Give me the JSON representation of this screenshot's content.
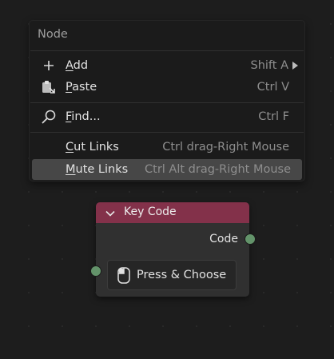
{
  "menu": {
    "title": "Node",
    "items": [
      {
        "label_u": "A",
        "label_rest": "dd",
        "shortcut": "Shift A",
        "icon": "plus-icon",
        "submenu": true
      },
      {
        "label_u": "P",
        "label_rest": "aste",
        "shortcut": "Ctrl V",
        "icon": "paste-icon"
      },
      {
        "label_u": "F",
        "label_rest": "ind...",
        "shortcut": "Ctrl F",
        "icon": "search-icon"
      },
      {
        "label_u": "C",
        "label_rest": "ut Links",
        "shortcut": "Ctrl drag-Right Mouse"
      },
      {
        "label_u": "M",
        "label_rest": "ute Links",
        "shortcut": "Ctrl Alt drag-Right Mouse",
        "active": true
      }
    ]
  },
  "node": {
    "title": "Key Code",
    "header_color": "#83314a",
    "output_label": "Code",
    "button_label": "Press & Choose",
    "socket_color": "#63936a"
  }
}
